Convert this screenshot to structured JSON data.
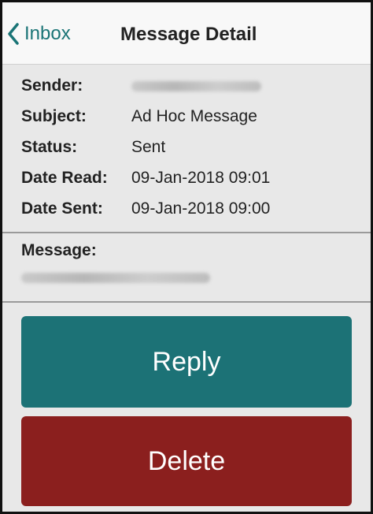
{
  "nav": {
    "back_label": "Inbox",
    "title": "Message Detail"
  },
  "details": {
    "sender_label": "Sender:",
    "subject_label": "Subject:",
    "subject_value": "Ad Hoc Message",
    "status_label": "Status:",
    "status_value": "Sent",
    "date_read_label": "Date Read:",
    "date_read_value": "09-Jan-2018 09:01",
    "date_sent_label": "Date Sent:",
    "date_sent_value": "09-Jan-2018 09:00"
  },
  "message": {
    "label": "Message:"
  },
  "actions": {
    "reply_label": "Reply",
    "delete_label": "Delete"
  },
  "colors": {
    "accent": "#1c7276",
    "danger": "#8b1f1e",
    "background": "#e8e8e8",
    "navbar": "#f8f8f8"
  },
  "icons": {
    "back": "chevron-left-icon"
  }
}
